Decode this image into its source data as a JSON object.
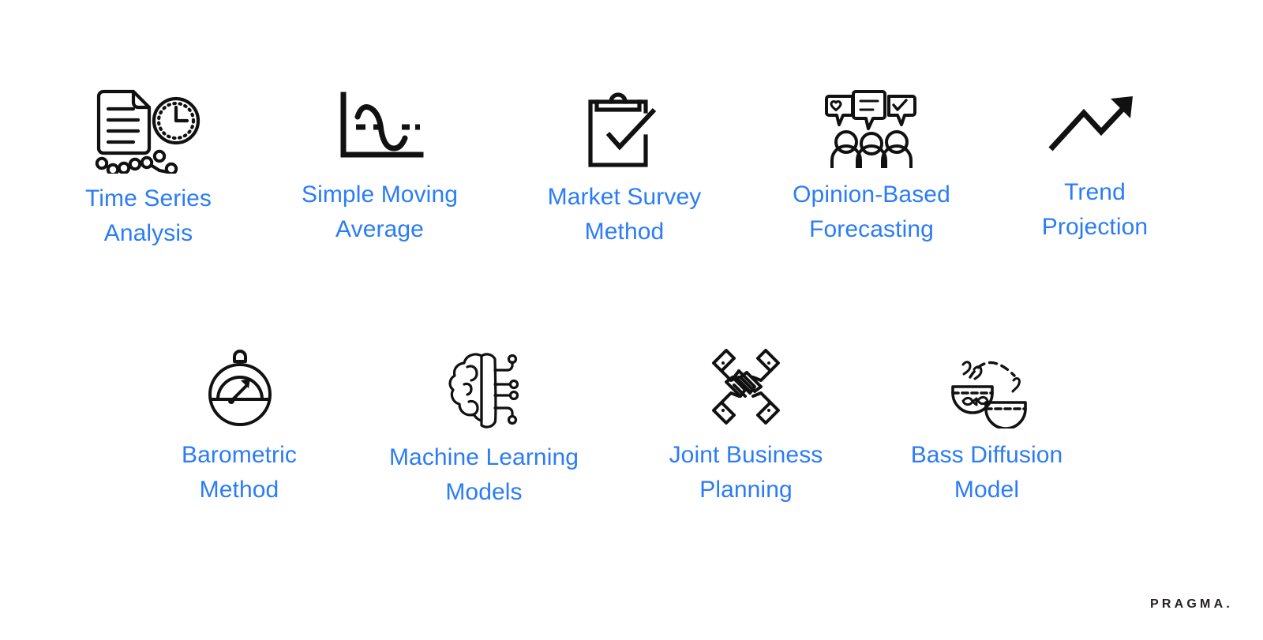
{
  "page": {
    "background_color": "#ffffff",
    "label_color": "#2b7cf6",
    "icon_color": "#111111",
    "brand": "PRAGMA."
  },
  "cards": [
    {
      "id": "time-series-analysis",
      "label": "Time Series\nAnalysis",
      "icon": "document-clock-linechart-icon"
    },
    {
      "id": "simple-moving-average",
      "label": "Simple Moving\nAverage",
      "icon": "axis-wave-dotted-line-icon"
    },
    {
      "id": "market-survey-method",
      "label": "Market Survey\nMethod",
      "icon": "clipboard-checkmark-icon"
    },
    {
      "id": "opinion-based-forecasting",
      "label": "Opinion-Based\nForecasting",
      "icon": "people-speech-bubbles-icon"
    },
    {
      "id": "trend-projection",
      "label": "Trend\nProjection",
      "icon": "zigzag-up-arrow-icon"
    },
    {
      "id": "barometric-method",
      "label": "Barometric\nMethod",
      "icon": "barometer-gauge-icon"
    },
    {
      "id": "machine-learning-models",
      "label": "Machine Learning\nModels",
      "icon": "brain-circuit-icon"
    },
    {
      "id": "joint-business-planning",
      "label": "Joint Business\nPlanning",
      "icon": "four-hands-teamwork-icon"
    },
    {
      "id": "bass-diffusion-model",
      "label": "Bass Diffusion\nModel",
      "icon": "fish-bowls-jumping-fish-icon"
    }
  ]
}
